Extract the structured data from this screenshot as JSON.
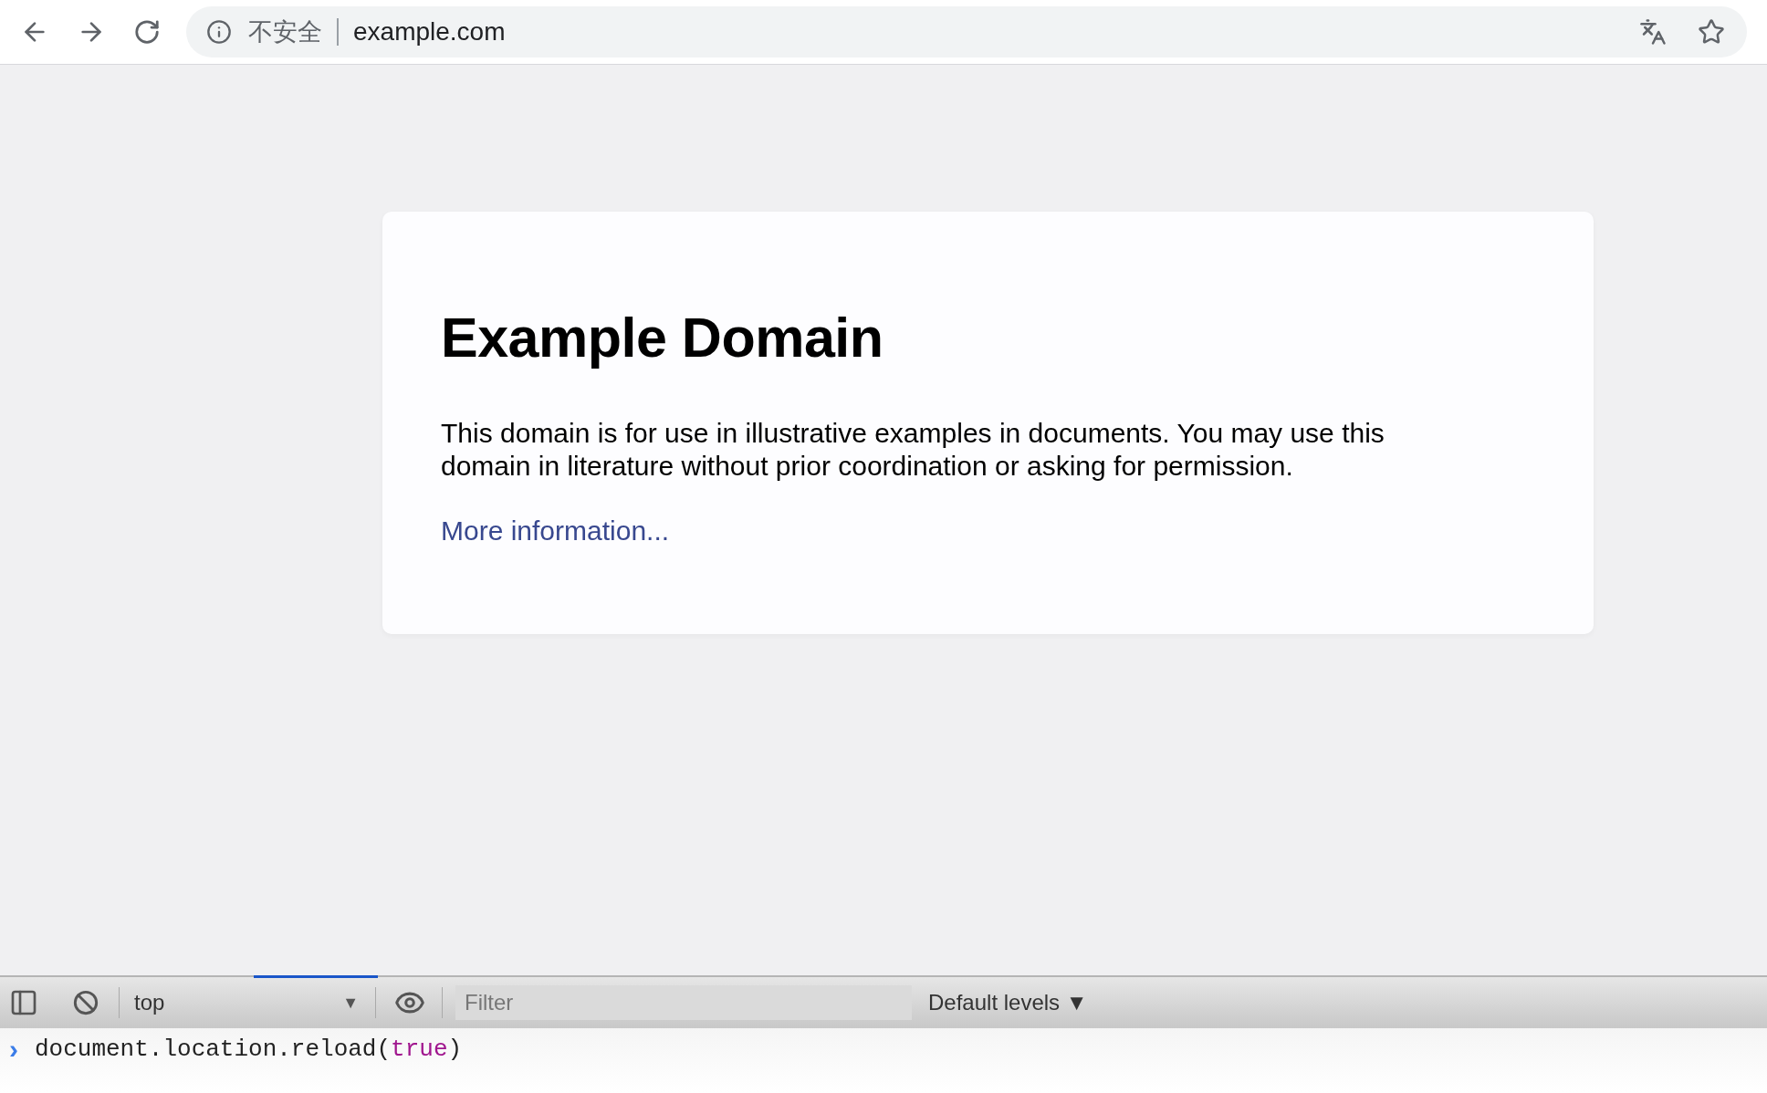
{
  "browser": {
    "security_label": "不安全",
    "url": "example.com"
  },
  "page": {
    "heading": "Example Domain",
    "paragraph": "This domain is for use in illustrative examples in documents. You may use this domain in literature without prior coordination or asking for permission.",
    "link": "More information..."
  },
  "devtools": {
    "context": "top",
    "context_caret": "▼",
    "filter_placeholder": "Filter",
    "levels": "Default levels ▼",
    "prompt": "›",
    "command": [
      {
        "kind": "plain",
        "text": "document.location.reload("
      },
      {
        "kind": "keyword",
        "text": "true"
      },
      {
        "kind": "plain",
        "text": ")"
      }
    ]
  }
}
